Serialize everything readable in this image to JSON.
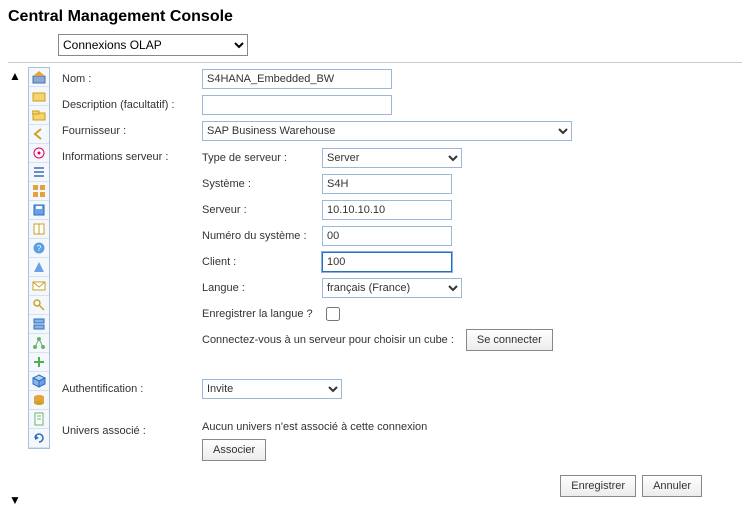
{
  "page_title": "Central Management Console",
  "top_select_value": "Connexions OLAP",
  "labels": {
    "name": "Nom :",
    "description": "Description (facultatif) :",
    "provider": "Fournisseur :",
    "server_info": "Informations serveur :",
    "server_type": "Type de serveur :",
    "system": "Système :",
    "server": "Serveur :",
    "system_number": "Numéro du système :",
    "client": "Client :",
    "language": "Langue :",
    "save_language": "Enregistrer la langue ?",
    "connect_hint": "Connectez-vous à un serveur pour choisir un cube :",
    "auth": "Authentification :",
    "assoc_univ": "Univers associé :"
  },
  "values": {
    "name": "S4HANA_Embedded_BW",
    "description": "",
    "provider": "SAP Business Warehouse",
    "server_type": "Server",
    "system": "S4H",
    "server": "10.10.10.10",
    "system_number": "00",
    "client": "100",
    "language": "français (France)",
    "auth": "Invite",
    "no_universe": "Aucun univers n'est associé à cette connexion"
  },
  "buttons": {
    "connect": "Se connecter",
    "associate": "Associer",
    "save": "Enregistrer",
    "cancel": "Annuler"
  }
}
